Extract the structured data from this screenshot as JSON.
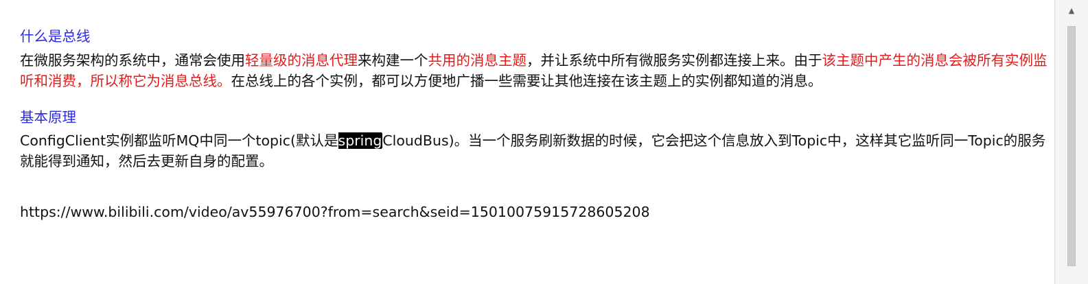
{
  "section1": {
    "heading": "什么是总线",
    "p1_a": "在微服务架构的系统中，通常会使用",
    "p1_b": "轻量级的消息代理",
    "p1_c": "来构建一个",
    "p1_d": "共用的消息主题",
    "p1_e": "，并让系统中所有微服务实例都连接上来。由于",
    "p1_f": "该主题中产生的消息会被所有实例监听和消费，所以称它为消息总线。",
    "p1_g": "在总线上的各个实例，都可以方便地广播一些需要让其他连接在该主题上的实例都知道的消息。"
  },
  "section2": {
    "heading": "基本原理",
    "p2_a": "ConfigClient实例都监听MQ中同一个topic(默认是",
    "p2_sel": "spring",
    "p2_b": "CloudBus)。当一个服务刷新数据的时候，它会把这个信息放入到Topic中，这样其它监听同一Topic的服务就能得到通知，然后去更新自身的配置。"
  },
  "link": "https://www.bilibili.com/video/av55976700?from=search&seid=15010075915728605208",
  "colors": {
    "heading": "#2a2ae0",
    "highlight": "#e31b1b",
    "text": "#111111",
    "selection": "#000000"
  },
  "icons": {
    "scroll_up": "scroll-up-arrow-icon"
  }
}
